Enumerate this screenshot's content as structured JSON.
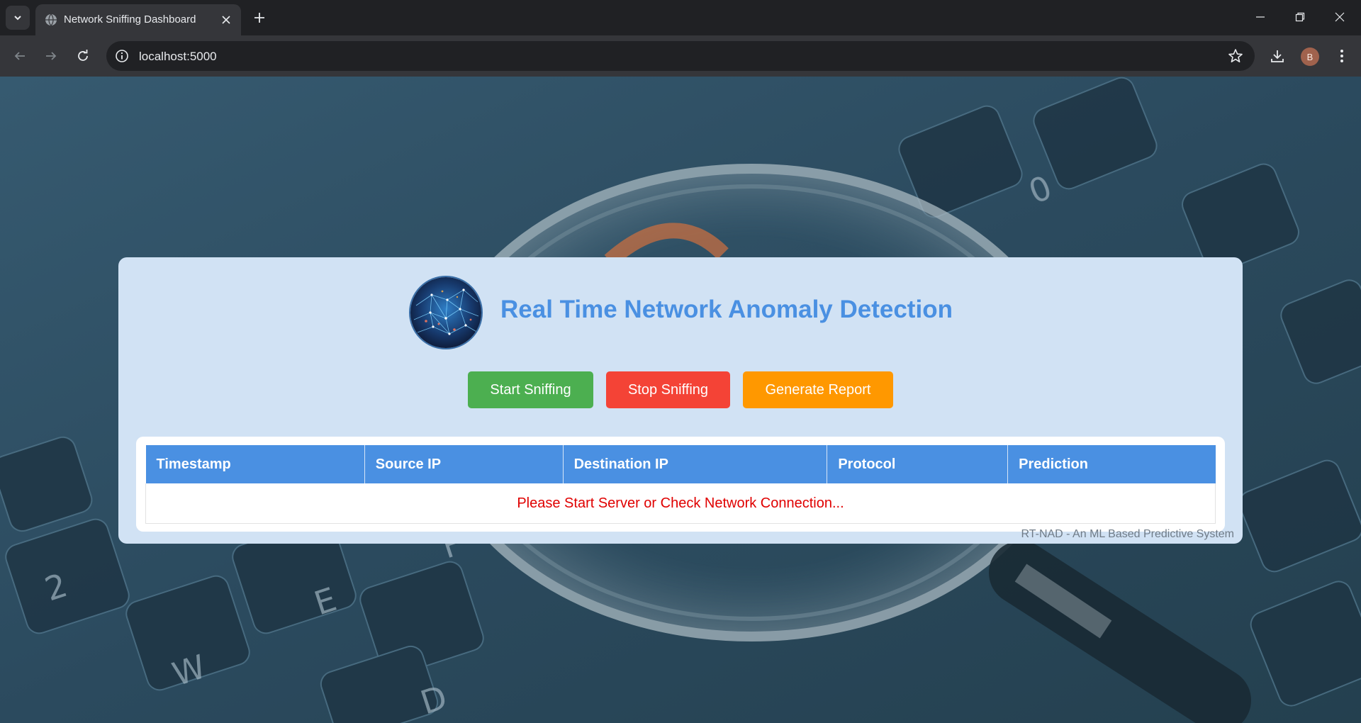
{
  "browser": {
    "tab_title": "Network Sniffing Dashboard",
    "url": "localhost:5000",
    "profile_initial": "B"
  },
  "page": {
    "title": "Real Time Network Anomaly Detection",
    "buttons": {
      "start": "Start Sniffing",
      "stop": "Stop Sniffing",
      "report": "Generate Report"
    },
    "table": {
      "headers": [
        "Timestamp",
        "Source IP",
        "Destination IP",
        "Protocol",
        "Prediction"
      ],
      "status_message": "Please Start Server or Check Network Connection..."
    },
    "footer": "RT-NAD - An ML Based Predictive System"
  },
  "colors": {
    "accent": "#4a90e2",
    "start": "#4caf50",
    "stop": "#f44336",
    "report": "#ff9800",
    "status_error": "#e00000"
  }
}
